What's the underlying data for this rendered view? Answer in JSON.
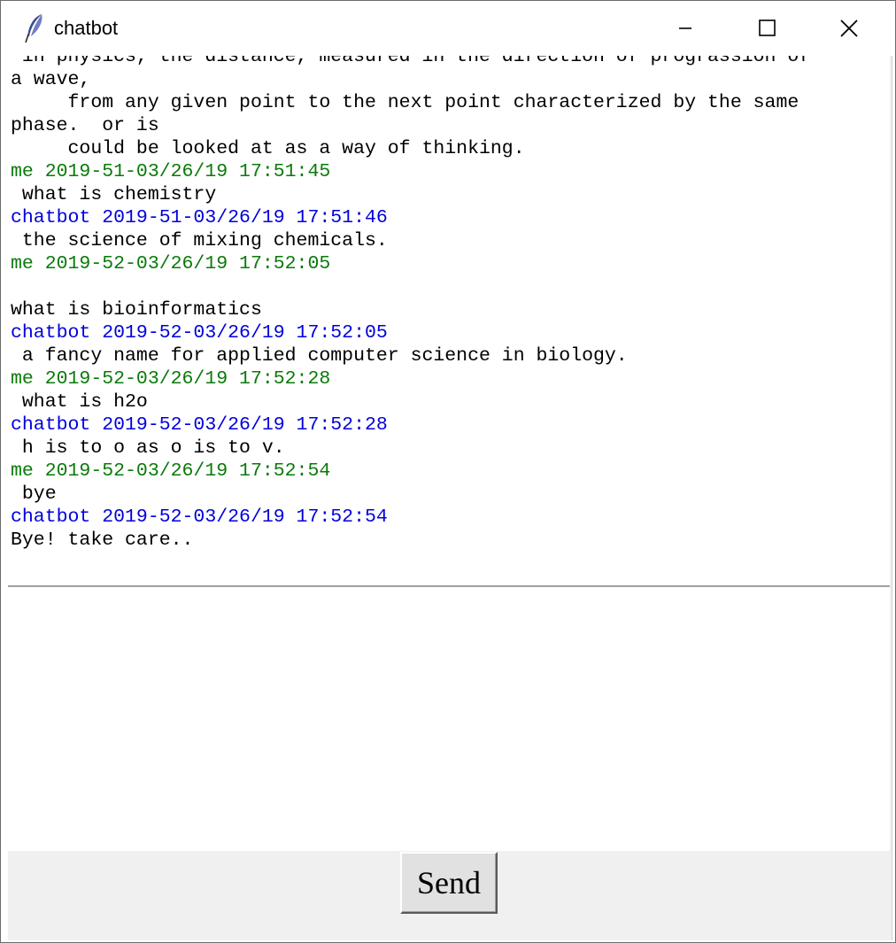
{
  "window": {
    "title": "chatbot",
    "icon": "feather-icon"
  },
  "colors": {
    "me_header": "#0a7a0a",
    "chatbot_header": "#0000dd",
    "message_text": "#000000"
  },
  "chatlog": {
    "lines": [
      {
        "kind": "text",
        "text": " in physics, the distance, measured in the direction of prograssion of"
      },
      {
        "kind": "text",
        "text": "a wave,"
      },
      {
        "kind": "text",
        "text": "     from any given point to the next point characterized by the same"
      },
      {
        "kind": "text",
        "text": "phase.  or is"
      },
      {
        "kind": "text",
        "text": "     could be looked at as a way of thinking."
      },
      {
        "kind": "me",
        "text": "me 2019-51-03/26/19 17:51:45"
      },
      {
        "kind": "text",
        "text": " what is chemistry"
      },
      {
        "kind": "chatbot",
        "text": "chatbot 2019-51-03/26/19 17:51:46"
      },
      {
        "kind": "text",
        "text": " the science of mixing chemicals."
      },
      {
        "kind": "me",
        "text": "me 2019-52-03/26/19 17:52:05"
      },
      {
        "kind": "text",
        "text": ""
      },
      {
        "kind": "text",
        "text": "what is bioinformatics"
      },
      {
        "kind": "chatbot",
        "text": "chatbot 2019-52-03/26/19 17:52:05"
      },
      {
        "kind": "text",
        "text": " a fancy name for applied computer science in biology."
      },
      {
        "kind": "me",
        "text": "me 2019-52-03/26/19 17:52:28"
      },
      {
        "kind": "text",
        "text": " what is h2o"
      },
      {
        "kind": "chatbot",
        "text": "chatbot 2019-52-03/26/19 17:52:28"
      },
      {
        "kind": "text",
        "text": " h is to o as o is to v."
      },
      {
        "kind": "me",
        "text": "me 2019-52-03/26/19 17:52:54"
      },
      {
        "kind": "text",
        "text": " bye"
      },
      {
        "kind": "chatbot",
        "text": "chatbot 2019-52-03/26/19 17:52:54"
      },
      {
        "kind": "text",
        "text": "Bye! take care.."
      }
    ]
  },
  "input": {
    "value": "",
    "placeholder": ""
  },
  "send_button": {
    "label": "Send"
  }
}
